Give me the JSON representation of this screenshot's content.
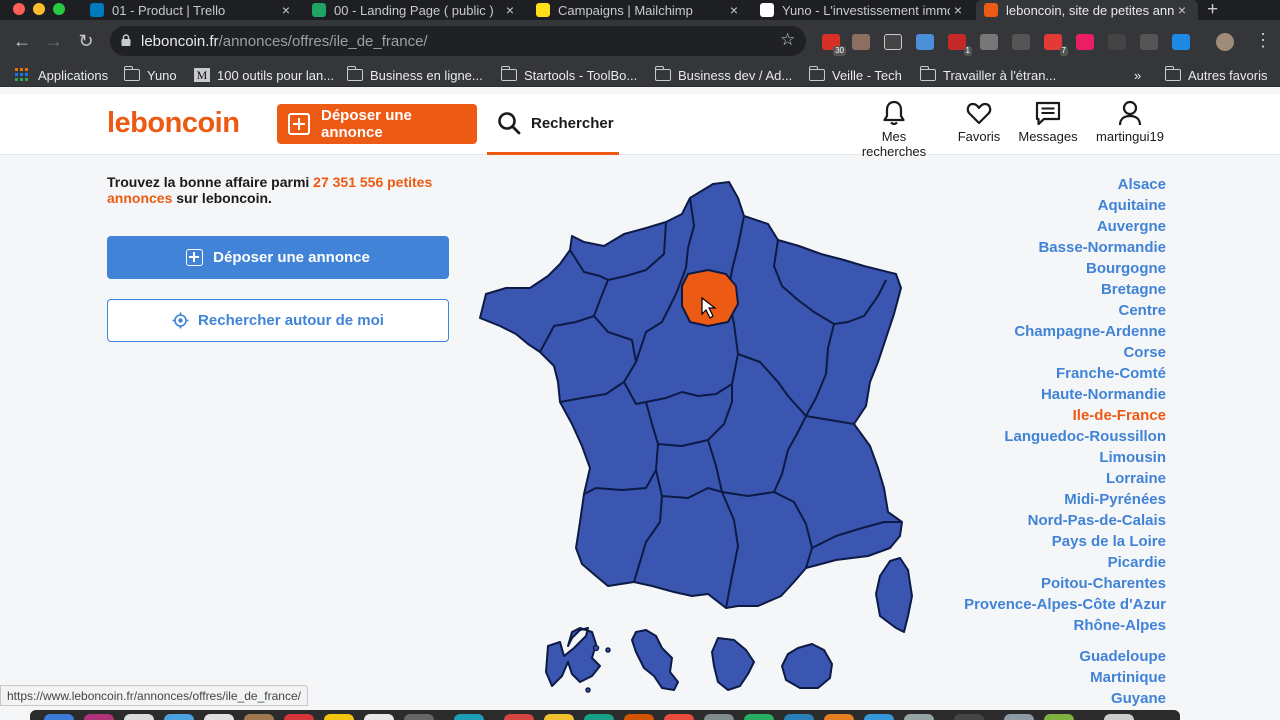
{
  "browser": {
    "tabs": [
      {
        "label": "01 - Product | Trello",
        "color": "#0079bf"
      },
      {
        "label": "00 - Landing Page ( public )",
        "color": "#1fa463"
      },
      {
        "label": "Campaigns | Mailchimp",
        "color": "#ffe01b"
      },
      {
        "label": "Yuno - L'investissement immobilier",
        "color": "#ffffff"
      },
      {
        "label": "leboncoin, site de petites annonces",
        "color": "#ec5a13",
        "active": true
      }
    ],
    "url_host": "leboncoin.fr",
    "url_path": "/annonces/offres/ile_de_france/",
    "extension_badges": [
      "30",
      "1",
      "7"
    ],
    "bookmarks": [
      {
        "label": "Applications",
        "icon": "apps-grid-icon"
      },
      {
        "label": "Yuno",
        "icon": "folder-icon"
      },
      {
        "label": "100 outils pour lan...",
        "icon": "medium-icon"
      },
      {
        "label": "Business en ligne...",
        "icon": "folder-icon"
      },
      {
        "label": "Startools - ToolBo...",
        "icon": "folder-icon"
      },
      {
        "label": "Business dev / Ad...",
        "icon": "folder-icon"
      },
      {
        "label": "Veille - Tech",
        "icon": "folder-icon"
      },
      {
        "label": "Travailler à l'étran...",
        "icon": "folder-icon"
      }
    ],
    "bookmarks_more": "»",
    "other_bookmarks": "Autres favoris",
    "status_url": "https://www.leboncoin.fr/annonces/offres/ile_de_france/"
  },
  "header": {
    "logo": "leboncoin",
    "post_ad": "Déposer une annonce",
    "search": "Rechercher",
    "nav": {
      "searches": "Mes recherches",
      "favorites": "Favoris",
      "messages": "Messages",
      "user": "martingui19"
    }
  },
  "intro": {
    "text_before": "Trouvez la bonne affaire parmi ",
    "count": "27 351 556 petites annonces",
    "text_after": " sur leboncoin."
  },
  "buttons": {
    "post_ad": "Déposer une annonce",
    "search_nearby": "Rechercher autour de moi"
  },
  "regions": [
    "Alsace",
    "Aquitaine",
    "Auvergne",
    "Basse-Normandie",
    "Bourgogne",
    "Bretagne",
    "Centre",
    "Champagne-Ardenne",
    "Corse",
    "Franche-Comté",
    "Haute-Normandie",
    "Ile-de-France",
    "Languedoc-Roussillon",
    "Limousin",
    "Lorraine",
    "Midi-Pyrénées",
    "Nord-Pas-de-Calais",
    "Pays de la Loire",
    "Picardie",
    "Poitou-Charentes",
    "Provence-Alpes-Côte d'Azur",
    "Rhône-Alpes"
  ],
  "overseas": [
    "Guadeloupe",
    "Martinique",
    "Guyane"
  ],
  "selected_region": "Ile-de-France",
  "colors": {
    "brand": "#ec5a13",
    "link": "#4183d7",
    "map_fill": "#3a56b0",
    "map_selected": "#ec5a13"
  }
}
